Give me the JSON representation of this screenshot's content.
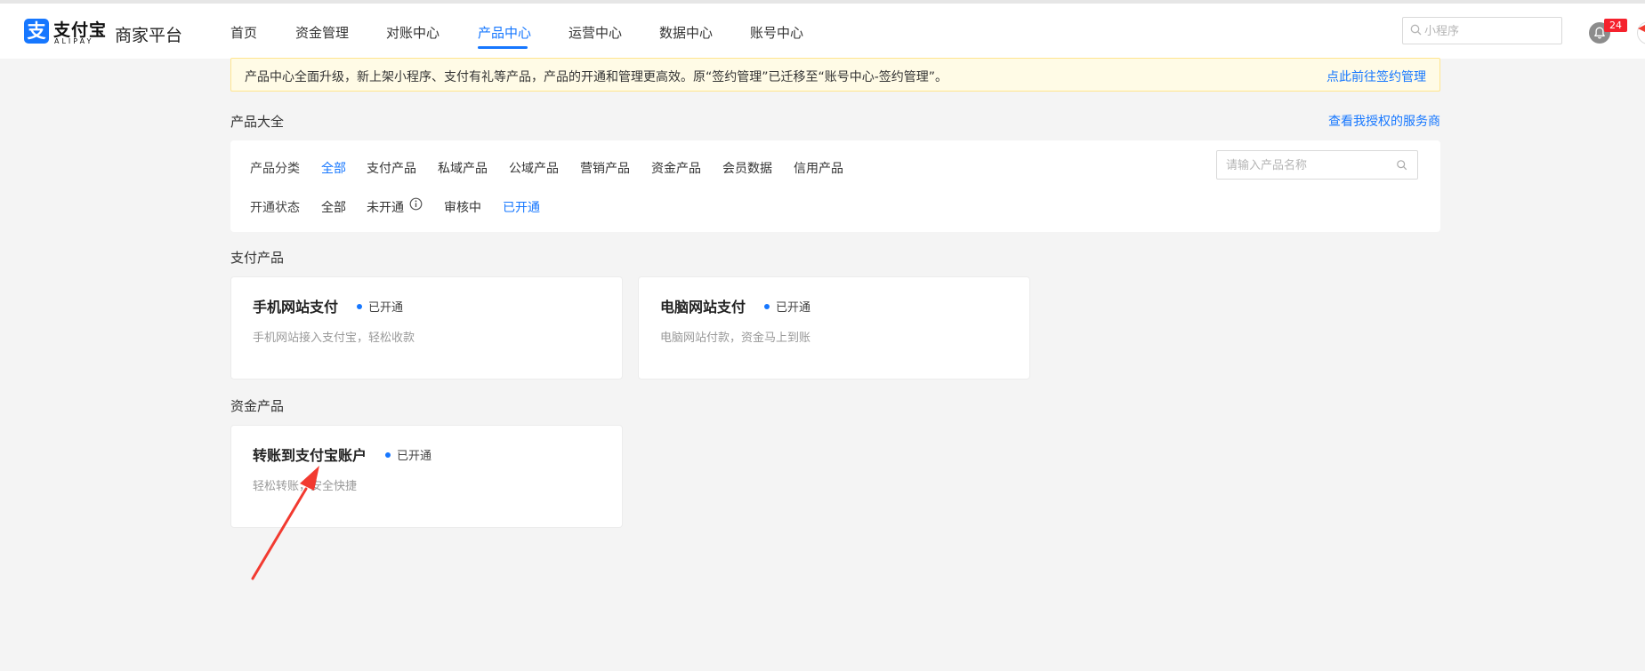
{
  "header": {
    "logo_icon": "支",
    "logo_cn": "支付宝",
    "logo_en": "ALIPAY",
    "platform_name": "商家平台",
    "nav": [
      {
        "label": "首页"
      },
      {
        "label": "资金管理"
      },
      {
        "label": "对账中心"
      },
      {
        "label": "产品中心"
      },
      {
        "label": "运营中心"
      },
      {
        "label": "数据中心"
      },
      {
        "label": "账号中心"
      }
    ],
    "active_nav": "产品中心",
    "search_placeholder": "小程序",
    "notification_count": "24"
  },
  "notice": {
    "text": "产品中心全面升级，新上架小程序、支付有礼等产品，产品的开通和管理更高效。原“签约管理”已迁移至“账号中心-签约管理”。",
    "link": "点此前往签约管理"
  },
  "catalog": {
    "title": "产品大全",
    "authorized_link": "查看我授权的服务商",
    "category_label": "产品分类",
    "categories": [
      "全部",
      "支付产品",
      "私域产品",
      "公域产品",
      "营销产品",
      "资金产品",
      "会员数据",
      "信用产品"
    ],
    "active_category": "全部",
    "status_label": "开通状态",
    "statuses": [
      "全部",
      "未开通",
      "审核中",
      "已开通"
    ],
    "active_status": "已开通",
    "search_placeholder": "请输入产品名称"
  },
  "groups": [
    {
      "title": "支付产品",
      "cards": [
        {
          "name": "手机网站支付",
          "status": "已开通",
          "desc": "手机网站接入支付宝，轻松收款"
        },
        {
          "name": "电脑网站支付",
          "status": "已开通",
          "desc": "电脑网站付款，资金马上到账"
        }
      ]
    },
    {
      "title": "资金产品",
      "cards": [
        {
          "name": "转账到支付宝账户",
          "status": "已开通",
          "desc": "轻松转账，安全快捷"
        }
      ]
    }
  ],
  "colors": {
    "accent": "#1677ff",
    "notice_bg": "#fffbe6",
    "annotation_arrow": "#f23a30"
  },
  "icons": {
    "search": "search-icon",
    "bell": "bell-icon",
    "info": "info-circle-icon",
    "status": "status-dot-icon"
  }
}
